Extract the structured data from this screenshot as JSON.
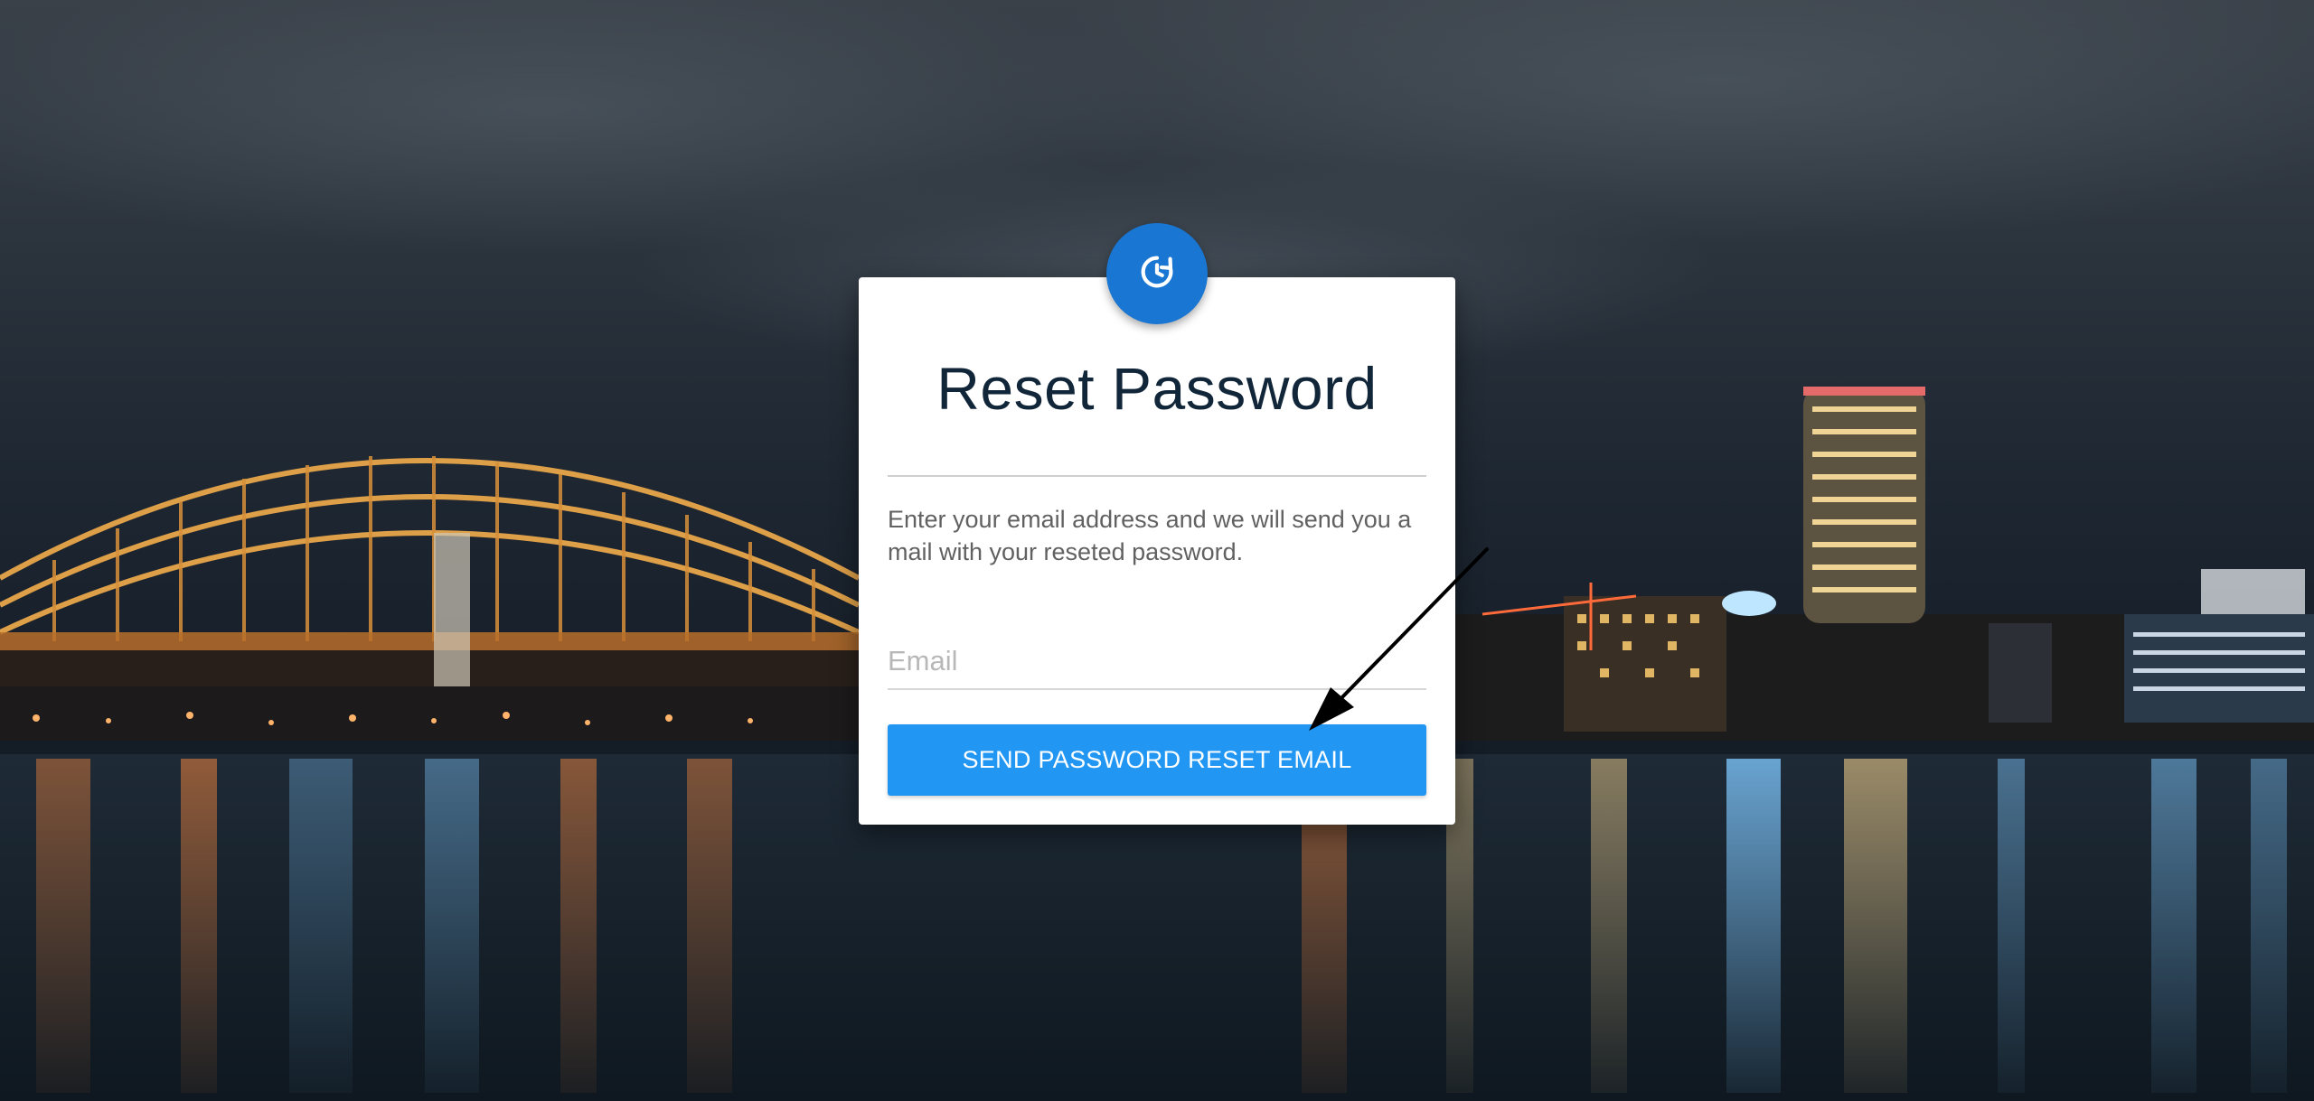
{
  "page": {
    "title": "Reset Password",
    "description": "Enter your email address and we will send you a mail with your reseted password."
  },
  "form": {
    "email_placeholder": "Email",
    "email_value": "",
    "submit_label": "SEND PASSWORD RESET EMAIL"
  },
  "icons": {
    "badge": "reset-clock-icon",
    "annotation": "annotation-arrow"
  },
  "colors": {
    "badge": "#1976d2",
    "button": "#2196f3",
    "title": "#12263a",
    "description": "#616161"
  }
}
